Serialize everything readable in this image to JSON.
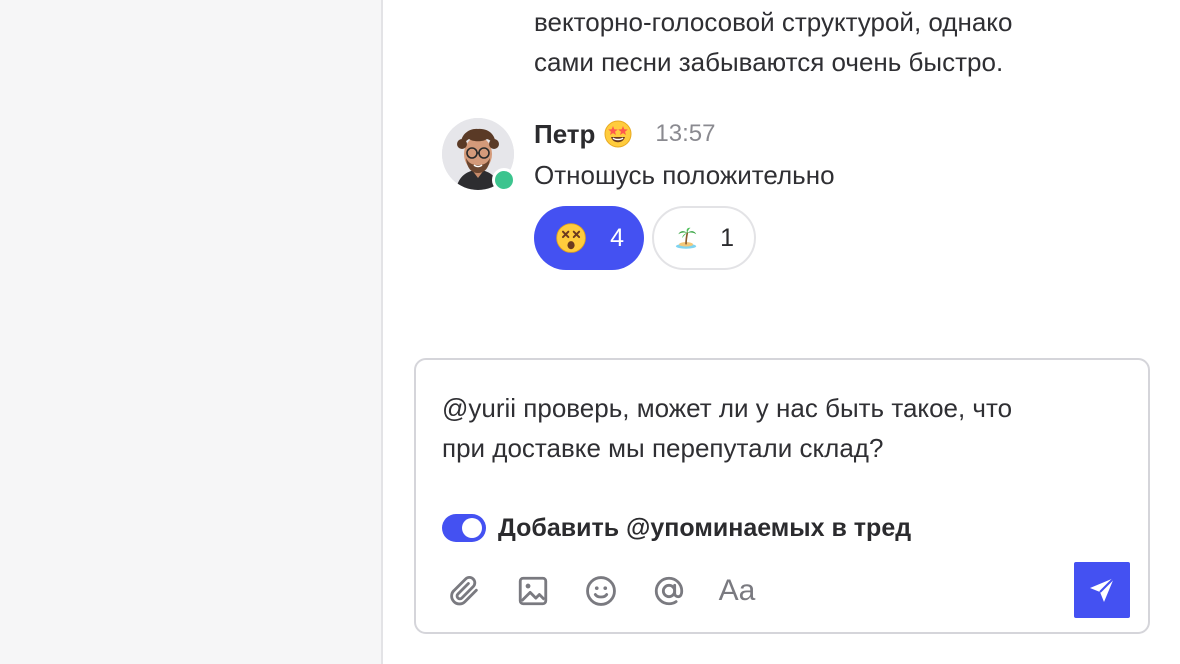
{
  "previous_message": {
    "line1": "векторно-голосовой структурой, однако",
    "line2": "сами песни забываются очень быстро."
  },
  "message": {
    "author": "Петр",
    "author_status_emoji": "star-struck-emoji",
    "time": "13:57",
    "text": "Отношусь положительно",
    "online": true,
    "reactions": [
      {
        "emoji": "dizzy-face-emoji",
        "count": "4",
        "active": true
      },
      {
        "emoji": "desert-island-emoji",
        "count": "1",
        "active": false
      }
    ]
  },
  "composer": {
    "line1": "@yurii проверь, может ли у нас быть такое, что",
    "line2": "при доставке мы перепутали склад?",
    "toggle_label": "Добавить @упоминаемых в тред",
    "toggle_on": true,
    "text_format_label": "Aa",
    "tools": [
      "paperclip-icon",
      "image-icon",
      "smiley-icon",
      "at-sign-icon",
      "text-format-icon"
    ],
    "send": "send-icon"
  },
  "colors": {
    "accent": "#4451f2",
    "online": "#3cc48e",
    "sidebar_bg": "#f6f6f7",
    "muted_text": "#8a8a90"
  }
}
